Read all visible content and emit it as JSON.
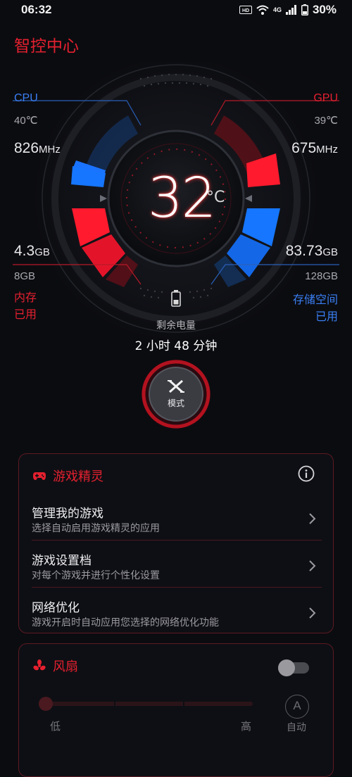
{
  "status_bar": {
    "time": "06:32",
    "network": "4G",
    "battery_percent": "30%",
    "icons": [
      "hd-icon",
      "wifi-icon",
      "signal-icon",
      "battery-icon"
    ]
  },
  "app": {
    "title": "智控中心"
  },
  "hud": {
    "cpu": {
      "label": "CPU",
      "temp": "40℃",
      "freq_value": "826",
      "freq_unit": "MHz"
    },
    "gpu": {
      "label": "GPU",
      "temp": "39℃",
      "freq_value": "675",
      "freq_unit": "MHz"
    },
    "memory": {
      "used_value": "4.3",
      "used_unit": "GB",
      "total": "8GB",
      "label_line1": "内存",
      "label_line2": "已用"
    },
    "storage": {
      "used_value": "83.73",
      "used_unit": "GB",
      "total": "128GB",
      "label_line1": "存储空间",
      "label_line2": "已用"
    },
    "temperature": {
      "value": "32",
      "unit": "C"
    },
    "battery": {
      "label": "剩余电量",
      "remaining": "2 小时 48 分钟"
    },
    "mode_button": {
      "label": "模式"
    }
  },
  "game_genie": {
    "title": "游戏精灵",
    "rows": [
      {
        "title": "管理我的游戏",
        "subtitle": "选择自动启用游戏精灵的应用"
      },
      {
        "title": "游戏设置档",
        "subtitle": "对每个游戏并进行个性化设置"
      },
      {
        "title": "网络优化",
        "subtitle": "游戏开启时自动应用您选择的网络优化功能"
      }
    ]
  },
  "fan": {
    "title": "风扇",
    "toggle_on": false,
    "slider": {
      "low_label": "低",
      "high_label": "高",
      "auto_label": "自动",
      "auto_icon_letter": "A",
      "level": 0
    }
  },
  "colors": {
    "accent_red": "#e5202f",
    "accent_blue": "#3a7ff4",
    "background": "#0b0c10"
  }
}
